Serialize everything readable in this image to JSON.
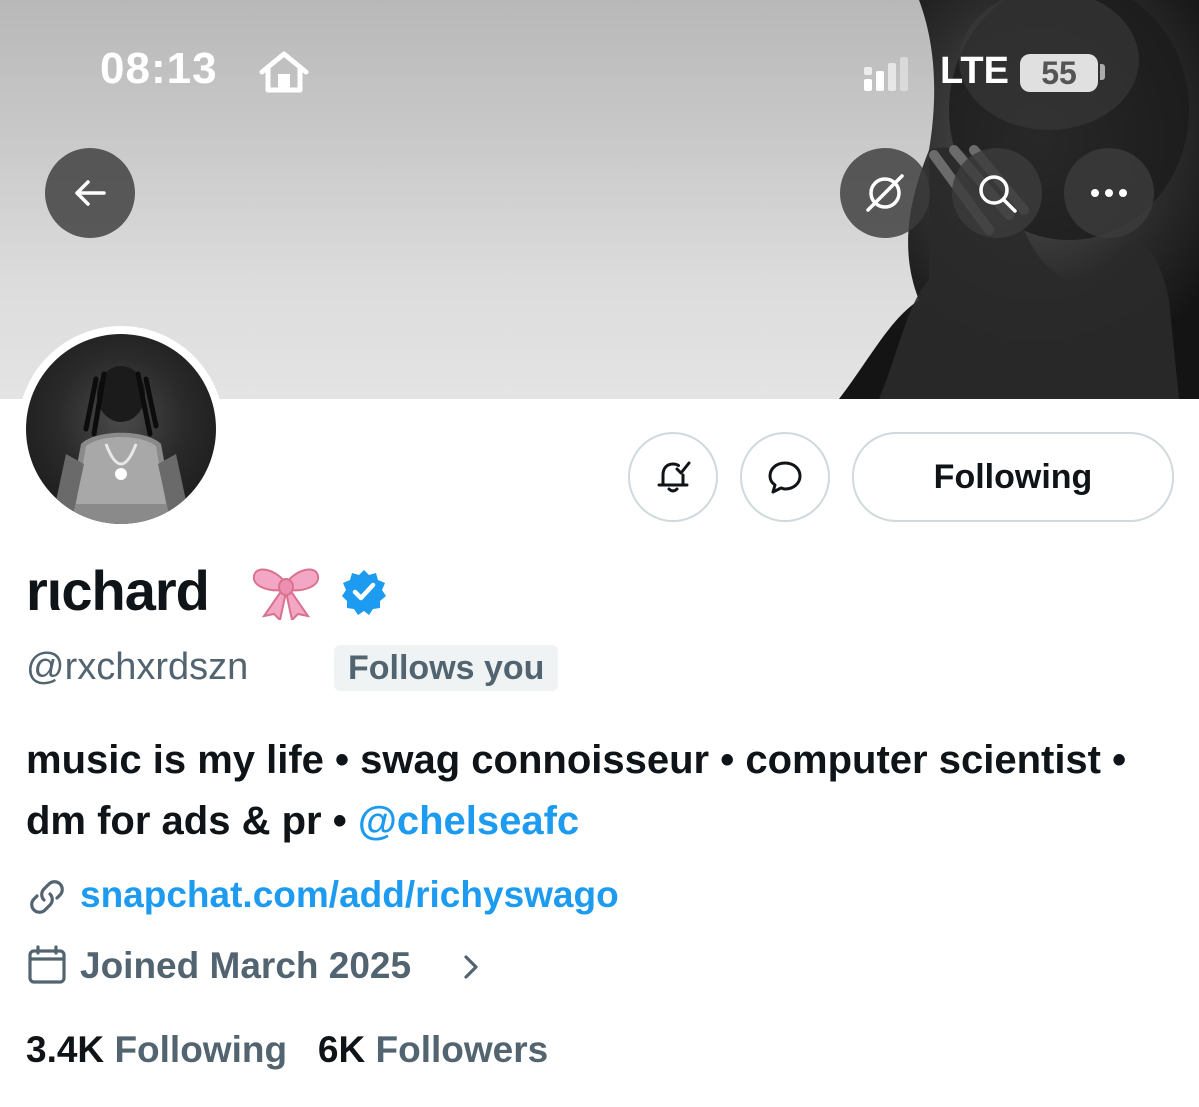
{
  "status_bar": {
    "time": "08:13",
    "network": "LTE",
    "battery": "55"
  },
  "header_icons": {
    "back": "back-arrow-icon",
    "grok": "grok-icon",
    "search": "search-icon",
    "more": "more-icon"
  },
  "actions": {
    "notify_icon": "bell-check-icon",
    "message_icon": "message-icon",
    "following_label": "Following"
  },
  "profile": {
    "display_name": "rιchard",
    "emoji": "🎀",
    "verified": true,
    "handle": "@rxchxrdszn",
    "follows_you": "Follows you",
    "bio_text": "music is my life • swag connoisseur • computer scientist • dm for ads & pr • ",
    "bio_mention": "@chelseafc",
    "website": "snapchat.com/add/richyswago",
    "joined": "Joined March 2025"
  },
  "stats": {
    "following_count": "3.4K",
    "following_label": "Following",
    "followers_count": "6K",
    "followers_label": "Followers"
  },
  "colors": {
    "accent": "#1d9bf0",
    "secondary_text": "#536471",
    "primary_text": "#0f1419",
    "border": "#cfd9de"
  }
}
